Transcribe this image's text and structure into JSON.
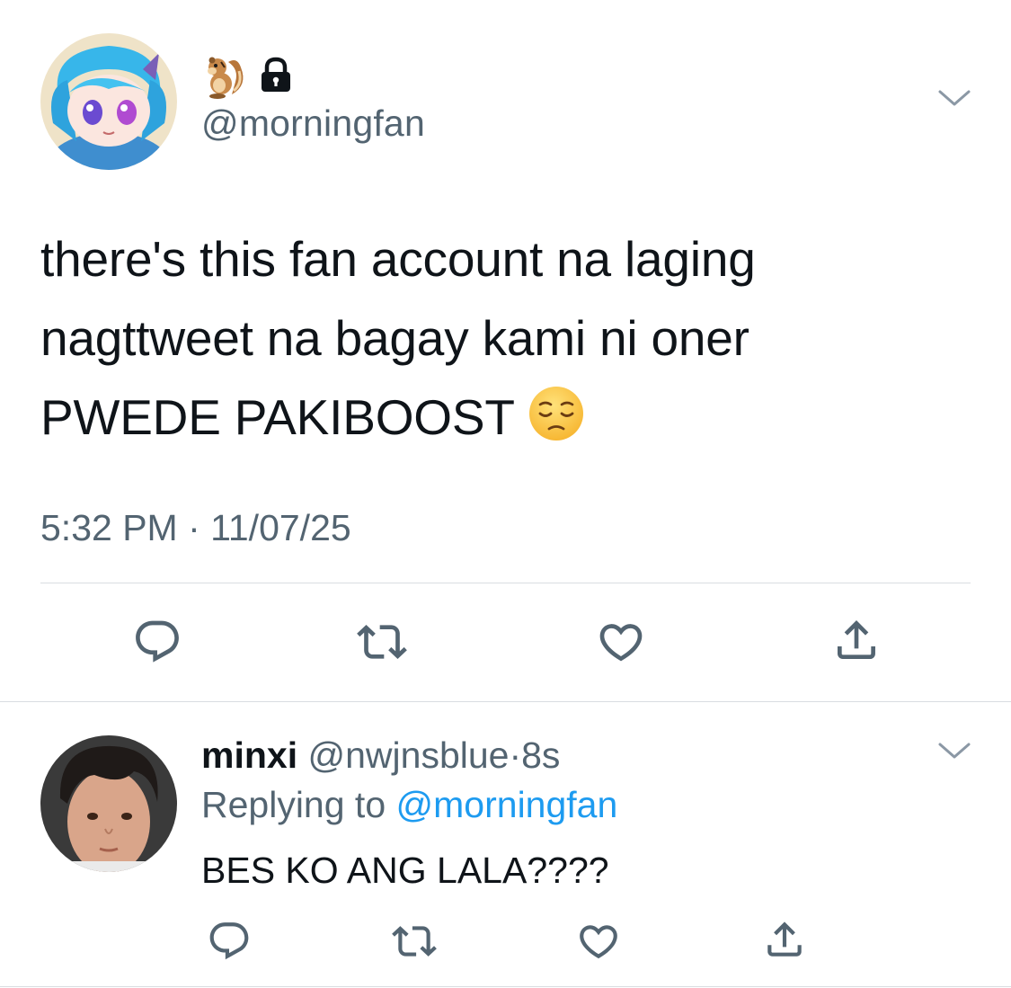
{
  "main_tweet": {
    "display_name_emojis": [
      "chipmunk-icon",
      "lock-icon"
    ],
    "handle": "@morningfan",
    "text_lines": [
      "there's this fan account na laging",
      "nagttweet na bagay kami ni oner",
      "PWEDE PAKIBOOST"
    ],
    "trailing_emoji": "pensive-face-icon",
    "timestamp": "5:32 PM · 11/07/25",
    "actions": [
      "reply-icon",
      "retweet-icon",
      "like-icon",
      "share-icon"
    ]
  },
  "reply_tweet": {
    "name": "minxi",
    "handle": "@nwjnsblue",
    "separator": "·",
    "time": "8s",
    "replying_prefix": "Replying to",
    "replying_to": "@morningfan",
    "text": "BES KO ANG LALA????",
    "actions": [
      "reply-icon",
      "retweet-icon",
      "like-icon",
      "share-icon"
    ]
  },
  "colors": {
    "text": "#0f1419",
    "secondary": "#536471",
    "link": "#1d9bf0",
    "divider": "#d9dde1",
    "icon": "#536471"
  }
}
